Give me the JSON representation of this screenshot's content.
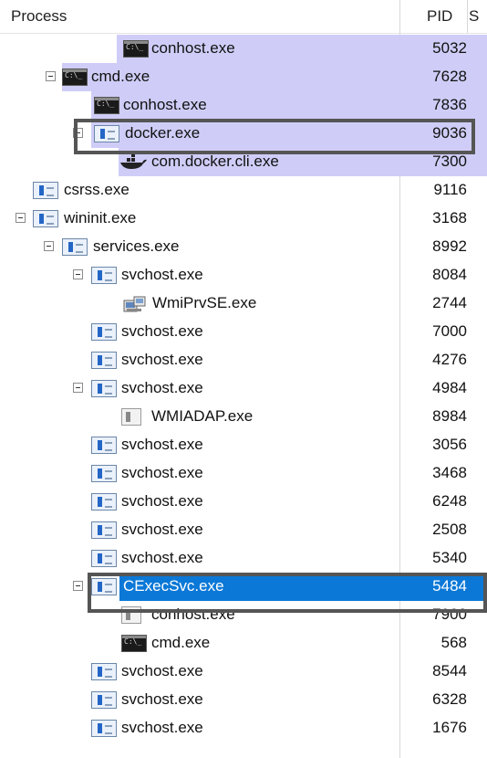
{
  "header": {
    "process_label": "Process",
    "pid_label": "PID",
    "extra_label": "S"
  },
  "colors": {
    "light_selection": "#cfcdf7",
    "blue_selection": "#0b78d7",
    "focus_outline": "#555555"
  },
  "processes": [
    {
      "name": "conhost.exe",
      "pid": "5032",
      "icon": "console-icon"
    },
    {
      "name": "cmd.exe",
      "pid": "7628",
      "icon": "console-icon",
      "expanded": true
    },
    {
      "name": "conhost.exe",
      "pid": "7836",
      "icon": "console-icon"
    },
    {
      "name": "docker.exe",
      "pid": "9036",
      "icon": "service-icon",
      "expanded": true
    },
    {
      "name": "com.docker.cli.exe",
      "pid": "7300",
      "icon": "docker-whale-icon"
    },
    {
      "name": "csrss.exe",
      "pid": "9116",
      "icon": "service-icon"
    },
    {
      "name": "wininit.exe",
      "pid": "3168",
      "icon": "service-icon",
      "expanded": true
    },
    {
      "name": "services.exe",
      "pid": "8992",
      "icon": "service-icon",
      "expanded": true
    },
    {
      "name": "svchost.exe",
      "pid": "8084",
      "icon": "service-icon",
      "expanded": true
    },
    {
      "name": "WmiPrvSE.exe",
      "pid": "2744",
      "icon": "wmi-provider-icon"
    },
    {
      "name": "svchost.exe",
      "pid": "7000",
      "icon": "service-icon"
    },
    {
      "name": "svchost.exe",
      "pid": "4276",
      "icon": "service-icon"
    },
    {
      "name": "svchost.exe",
      "pid": "4984",
      "icon": "service-icon",
      "expanded": true
    },
    {
      "name": "WMIADAP.exe",
      "pid": "8984",
      "icon": "generic-app-icon"
    },
    {
      "name": "svchost.exe",
      "pid": "3056",
      "icon": "service-icon"
    },
    {
      "name": "svchost.exe",
      "pid": "3468",
      "icon": "service-icon"
    },
    {
      "name": "svchost.exe",
      "pid": "6248",
      "icon": "service-icon"
    },
    {
      "name": "svchost.exe",
      "pid": "2508",
      "icon": "service-icon"
    },
    {
      "name": "svchost.exe",
      "pid": "5340",
      "icon": "service-icon"
    },
    {
      "name": "CExecSvc.exe",
      "pid": "5484",
      "icon": "service-icon",
      "expanded": true,
      "selected": true
    },
    {
      "name": "conhost.exe",
      "pid": "7900",
      "icon": "generic-app-icon"
    },
    {
      "name": "cmd.exe",
      "pid": "568",
      "icon": "console-icon"
    },
    {
      "name": "svchost.exe",
      "pid": "8544",
      "icon": "service-icon"
    },
    {
      "name": "svchost.exe",
      "pid": "6328",
      "icon": "service-icon"
    },
    {
      "name": "svchost.exe",
      "pid": "1676",
      "icon": "service-icon"
    }
  ]
}
